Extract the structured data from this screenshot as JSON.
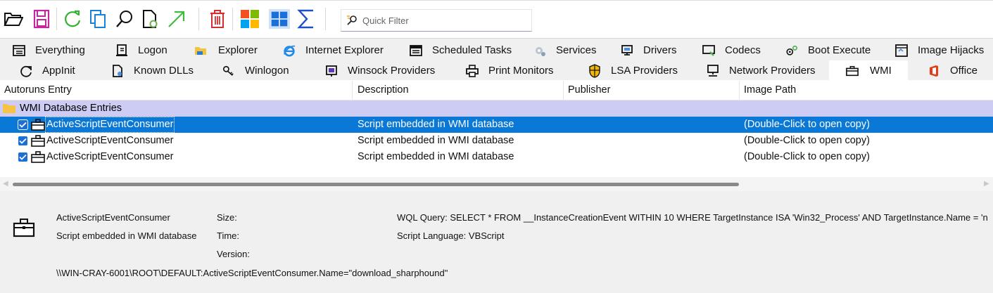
{
  "toolbar": {
    "buttons": [
      "open-icon",
      "save-icon",
      "refresh-icon",
      "copy-icon",
      "find-icon",
      "properties-icon",
      "jump-icon",
      "delete-icon",
      "windows-logo-icon",
      "tiles-icon",
      "sigma-icon"
    ],
    "filter_placeholder": "Quick Filter"
  },
  "tabs": {
    "row1": [
      "Everything",
      "Logon",
      "Explorer",
      "Internet Explorer",
      "Scheduled Tasks",
      "Services",
      "Drivers",
      "Codecs",
      "Boot Execute",
      "Image Hijacks"
    ],
    "row2": [
      "AppInit",
      "Known DLLs",
      "Winlogon",
      "Winsock Providers",
      "Print Monitors",
      "LSA Providers",
      "Network Providers",
      "WMI",
      "Office"
    ],
    "active": "WMI"
  },
  "columns": {
    "entry": "Autoruns Entry",
    "description": "Description",
    "publisher": "Publisher",
    "image_path": "Image Path"
  },
  "group": {
    "label": "WMI Database Entries"
  },
  "entries": [
    {
      "name": "ActiveScriptEventConsumer",
      "description": "Script embedded in WMI database",
      "publisher": "",
      "image_path": "(Double-Click to open copy)",
      "checked": true,
      "selected": true
    },
    {
      "name": "ActiveScriptEventConsumer",
      "description": "Script embedded in WMI database",
      "publisher": "",
      "image_path": "(Double-Click to open copy)",
      "checked": true,
      "selected": false
    },
    {
      "name": "ActiveScriptEventConsumer",
      "description": "Script embedded in WMI database",
      "publisher": "",
      "image_path": "(Double-Click to open copy)",
      "checked": true,
      "selected": false
    }
  ],
  "details": {
    "name": "ActiveScriptEventConsumer",
    "description": "Script embedded in WMI database",
    "size_label": "Size:",
    "time_label": "Time:",
    "version_label": "Version:",
    "wql_query": "WQL Query: SELECT * FROM __InstanceCreationEvent WITHIN 10 WHERE TargetInstance ISA 'Win32_Process' AND TargetInstance.Name = 'n",
    "script_language": "Script Language: VBScript",
    "path": "\\\\WIN-CRAY-6001\\ROOT\\DEFAULT:ActiveScriptEventConsumer.Name=\"download_sharphound\""
  },
  "colors": {
    "selection": "#0a78d7",
    "group_row": "#ccccf5",
    "checkbox": "#1a6fd8"
  }
}
